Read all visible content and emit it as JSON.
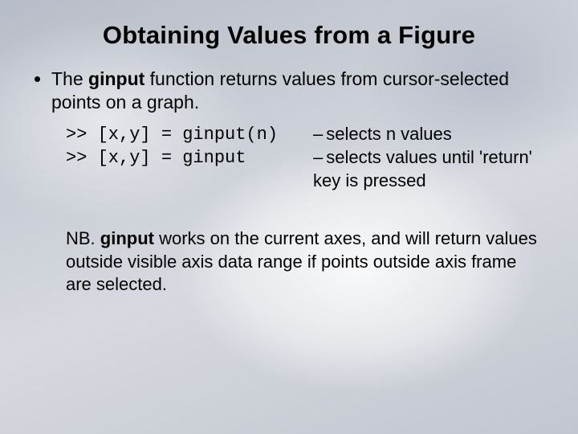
{
  "title": "Obtaining Values from a Figure",
  "bullet": {
    "pre": "The ",
    "kw": "ginput",
    "post": " function returns values from cursor-selected points on a graph."
  },
  "code": {
    "line1": ">> [x,y] = ginput(n)",
    "line2": ">> [x,y] = ginput",
    "desc1": "selects n values",
    "desc2": "selects values until 'return' key is pressed"
  },
  "note": {
    "pre": "NB. ",
    "kw": "ginput",
    "post": " works on the current axes, and will return values outside visible axis data range if points outside axis frame are selected."
  }
}
